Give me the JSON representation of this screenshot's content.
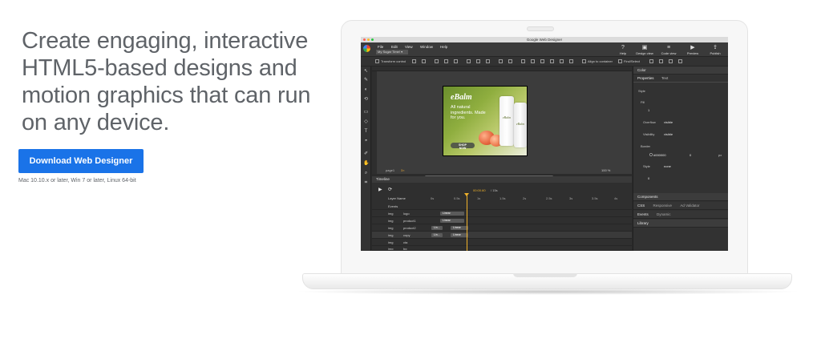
{
  "hero": {
    "title": "Create engaging, interactive HTML5-based designs and motion graphics that can run on any device.",
    "download_label": "Download Web Designer",
    "requirements": "Mac 10.10.x or later, Win 7 or later, Linux 64-bit"
  },
  "app": {
    "window_title": "Google Web Designer",
    "menu": [
      "File",
      "Edit",
      "View",
      "Window",
      "Help"
    ],
    "file_tab": "My Sugar Time!",
    "top_right": [
      {
        "label": "Help",
        "icon": "help-icon"
      },
      {
        "label": "Design view",
        "icon": "design-view-icon"
      },
      {
        "label": "Code view",
        "icon": "code-view-icon"
      },
      {
        "label": "Preview",
        "icon": "preview-icon"
      },
      {
        "label": "Publish",
        "icon": "publish-icon"
      }
    ],
    "toolbar": {
      "transform_control": "Transform control",
      "align_to_container": "Align to container",
      "find_object": "Find/Select"
    },
    "stage": {
      "page_label": "page1",
      "page_size": "3×",
      "zoom": "100 %"
    },
    "ad": {
      "brand": "eBalm",
      "copy": "All natural ingredients. Made for you.",
      "cta": "SHOP NOW",
      "tube_label": "eBalm"
    },
    "panel": {
      "color_header": "Color",
      "tabs": [
        "Properties",
        "Text"
      ],
      "style_section": "Style",
      "fill_label": "Fill",
      "fill_value": "1",
      "overflow_label": "Overflow",
      "overflow_value": "visible",
      "visibility_label": "Visibility",
      "visibility_value": "visible",
      "border_label": "Border",
      "border_color": "#000000",
      "border_width": "0",
      "border_unit": "px",
      "border_style_label": "Style",
      "border_style_value": "none",
      "radius_value": "0",
      "components_header": "Components",
      "css_tabs": [
        "CSS",
        "Responsive",
        "Ad Validator"
      ],
      "events_tabs": [
        "Events",
        "Dynamic"
      ],
      "library_header": "Library"
    },
    "timeline": {
      "header": "Timeline",
      "timecode": "00:00.60",
      "timecode_total": "/ 15s",
      "layer_name_header": "Layer Name",
      "ticks": [
        "0s",
        "0.5s",
        "1s",
        "1.5s",
        "2s",
        "2.5s",
        "3s",
        "3.5s",
        "4s"
      ],
      "rows": [
        {
          "tag": "",
          "layer": "Events"
        },
        {
          "tag": "img",
          "layer": "logo",
          "bar": "Linear"
        },
        {
          "tag": "img",
          "layer": "product1",
          "bar": "Linear"
        },
        {
          "tag": "img",
          "layer": "product2",
          "bar": "Lin...",
          "bar2": "Linear"
        },
        {
          "tag": "img",
          "layer": "copy",
          "bar": "Lin...",
          "bar2": "Linear"
        },
        {
          "tag": "img",
          "layer": "cta"
        },
        {
          "tag": "img",
          "layer": "bg"
        }
      ]
    }
  },
  "colors": {
    "accent": "#1a73e8",
    "timeline_playhead": "#f1b32b",
    "hero_text": "#5f6368"
  }
}
